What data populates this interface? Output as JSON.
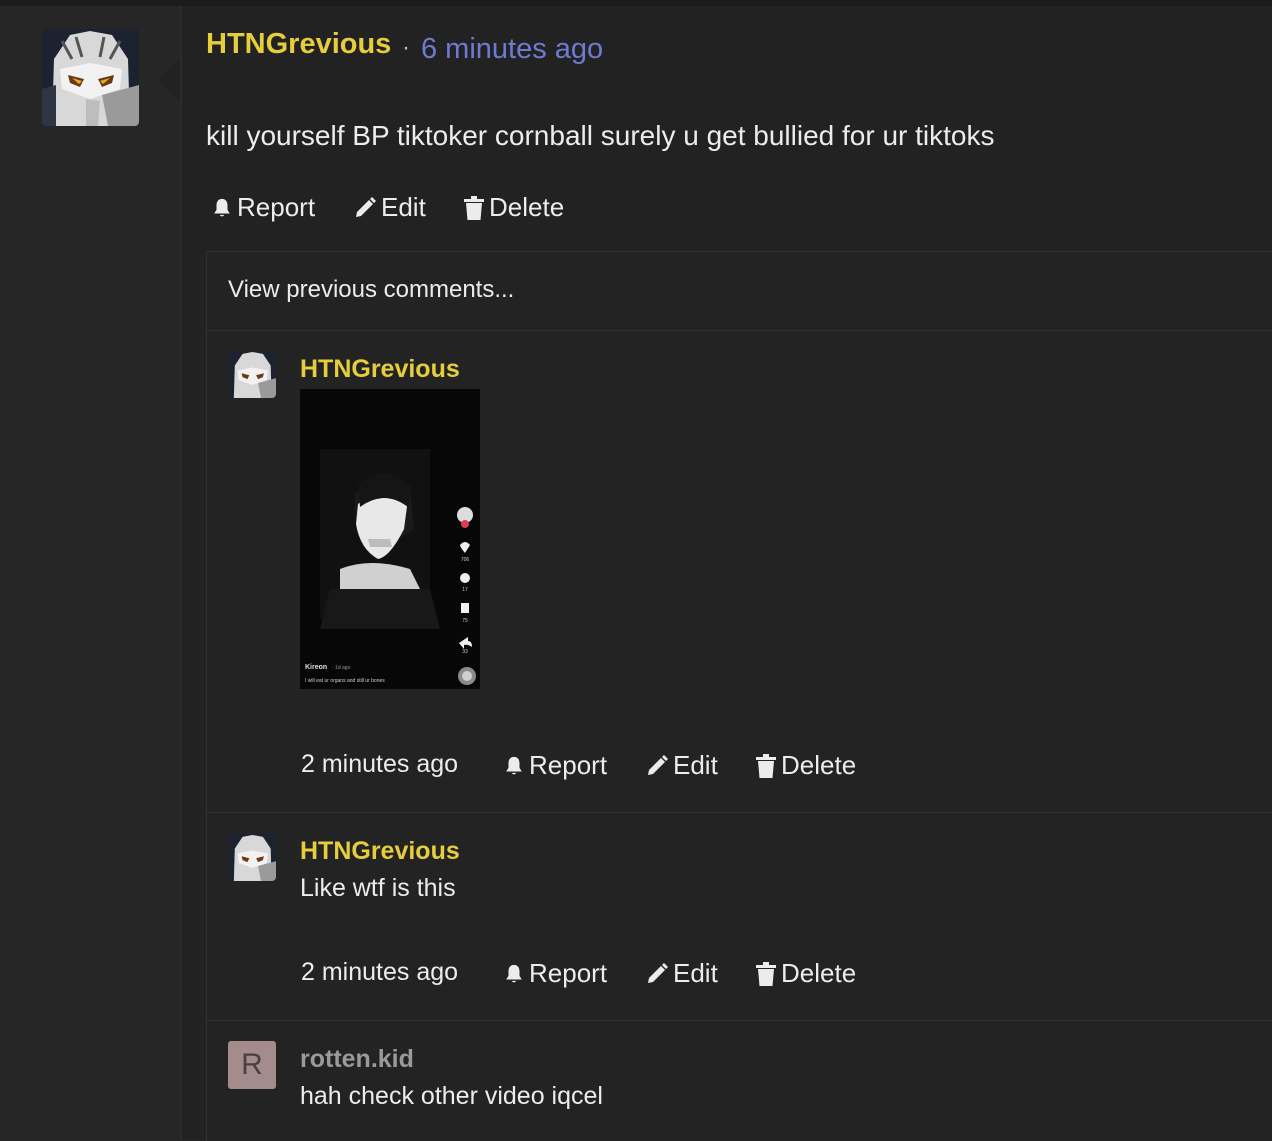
{
  "post": {
    "author": "HTNGrevious",
    "separator": "·",
    "time": "6 minutes ago",
    "body": "kill yourself BP tiktoker cornball surely u get bullied for ur tiktoks",
    "actions": {
      "report": "Report",
      "edit": "Edit",
      "delete": "Delete"
    }
  },
  "comments": {
    "view_previous": "View previous comments...",
    "items": [
      {
        "author": "HTNGrevious",
        "time": "2 minutes ago",
        "attachment": {
          "type": "video-screenshot",
          "username": "Kireon",
          "age": "· 1d ago",
          "caption": "I will eat ur organs and still ur bones",
          "likes": "706",
          "comments": "17",
          "saves": "75",
          "shares": "33"
        },
        "actions": {
          "report": "Report",
          "edit": "Edit",
          "delete": "Delete"
        }
      },
      {
        "author": "HTNGrevious",
        "text": "Like wtf is this",
        "time": "2 minutes ago",
        "actions": {
          "report": "Report",
          "edit": "Edit",
          "delete": "Delete"
        }
      },
      {
        "author": "rotten.kid",
        "avatar_letter": "R",
        "text": "hah check other video iqcel"
      }
    ]
  },
  "colors": {
    "author": "#e6cd3e",
    "timestamp_link": "#6f7bd1",
    "background": "#222222",
    "avatar_letter_bg": "#a48c8c"
  },
  "icons": [
    "bell-icon",
    "pencil-icon",
    "trash-icon"
  ]
}
